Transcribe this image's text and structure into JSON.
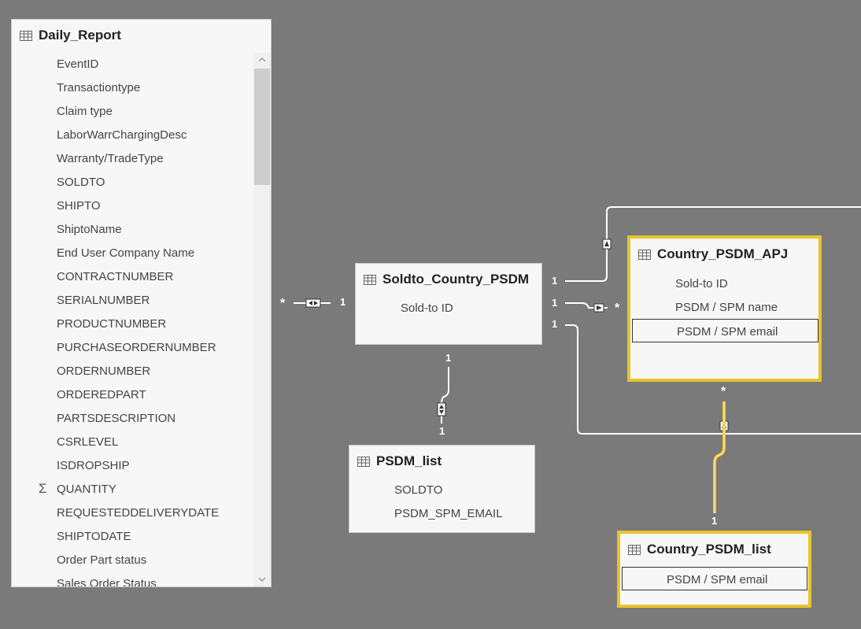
{
  "daily_report": {
    "title": "Daily_Report",
    "fields": [
      "EventID",
      "Transactiontype",
      "Claim type",
      "LaborWarrChargingDesc",
      "Warranty/TradeType",
      "SOLDTO",
      "SHIPTO",
      "ShiptoName",
      "End User Company Name",
      "CONTRACTNUMBER",
      "SERIALNUMBER",
      "PRODUCTNUMBER",
      "PURCHASEORDERNUMBER",
      "ORDERNUMBER",
      "ORDEREDPART",
      "PARTSDESCRIPTION",
      "CSRLEVEL",
      "ISDROPSHIP",
      "QUANTITY",
      "REQUESTEDDELIVERYDATE",
      "SHIPTODATE",
      "Order Part status",
      "Sales Order Status"
    ],
    "sum_symbol": "Σ"
  },
  "soldto_country_psdm": {
    "title": "Soldto_Country_PSDM",
    "fields": [
      "Sold-to ID"
    ]
  },
  "country_psdm_apj": {
    "title": "Country_PSDM_APJ",
    "fields": [
      "Sold-to ID",
      "PSDM / SPM name",
      "PSDM / SPM email"
    ]
  },
  "psdm_list": {
    "title": "PSDM_list",
    "fields": [
      "SOLDTO",
      "PSDM_SPM_EMAIL"
    ]
  },
  "country_psdm_list": {
    "title": "Country_PSDM_list",
    "fields": [
      "PSDM / SPM email"
    ]
  },
  "relationships": {
    "daily_to_soldto": {
      "left": "*",
      "right": "1"
    },
    "soldto_to_apj_top": {
      "left": "1"
    },
    "soldto_to_apj_mid": {
      "left": "1",
      "right": "*"
    },
    "soldto_to_apj_bottom": {
      "left": "1"
    },
    "soldto_to_psdm_list": {
      "top": "1",
      "bottom": "1"
    },
    "apj_to_country_list": {
      "top": "*",
      "bottom": "1"
    }
  },
  "colors": {
    "background": "#7a7a7a",
    "highlight": "#e8c32d",
    "card": "#f7f7f7"
  }
}
